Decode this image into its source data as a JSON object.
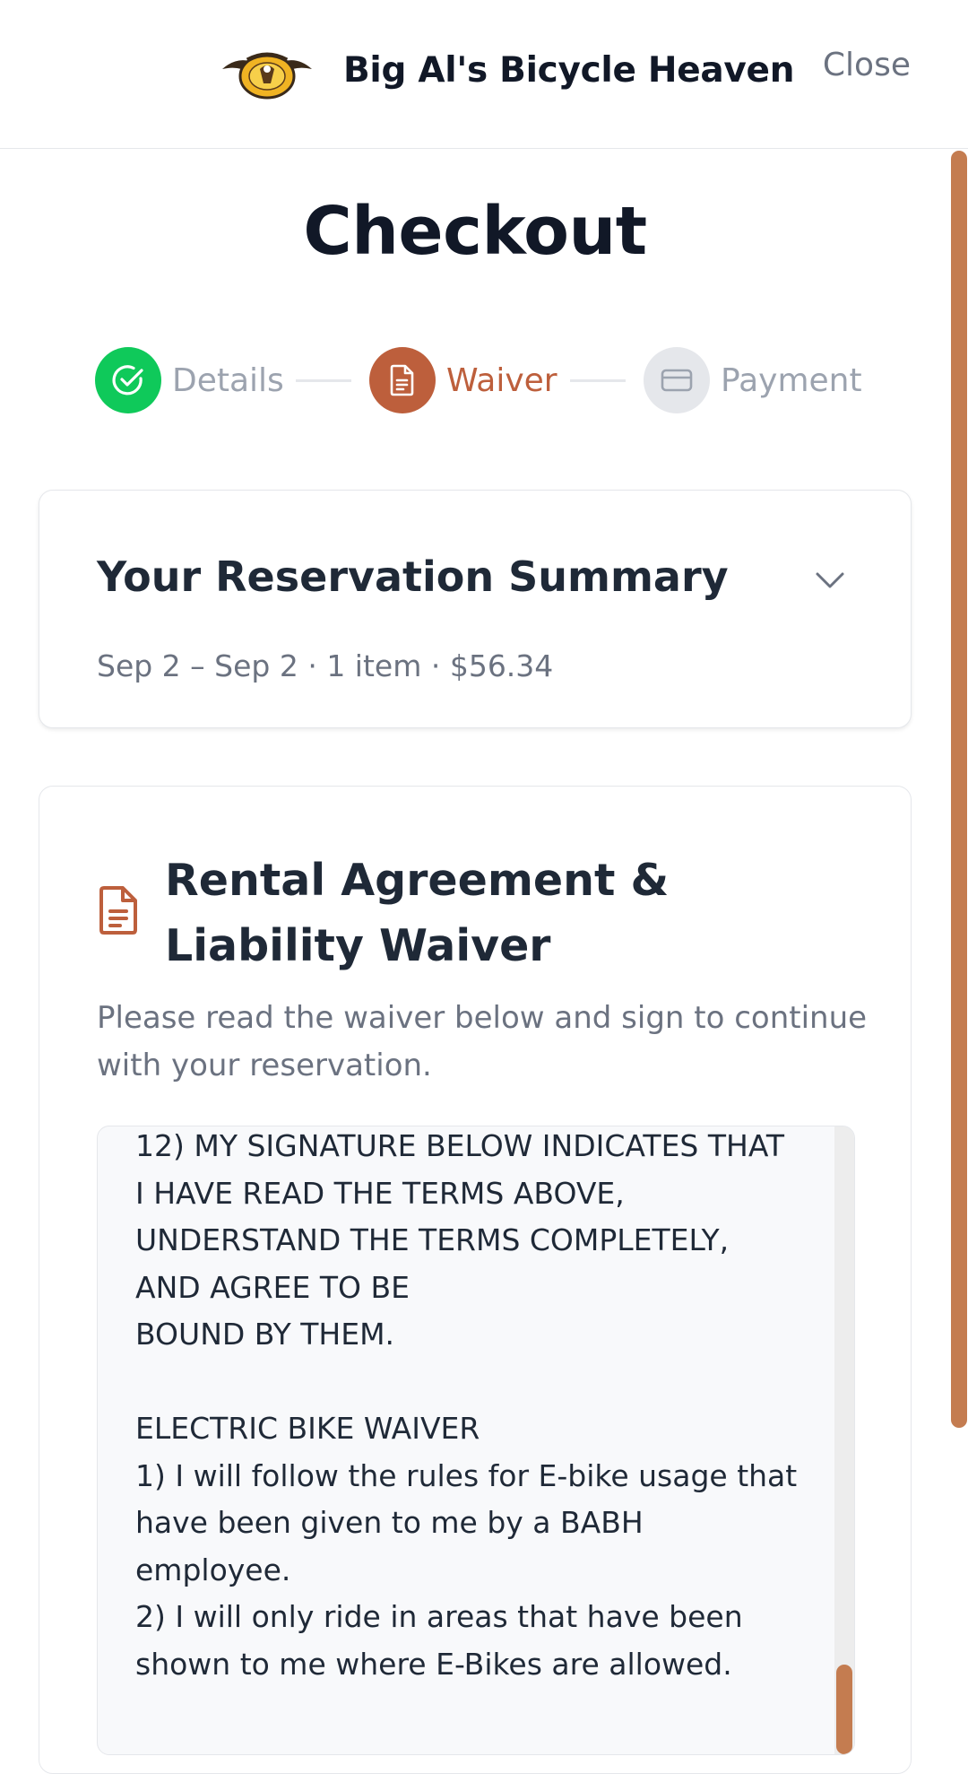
{
  "header": {
    "brand_name": "Big Al's Bicycle Heaven",
    "logo_icon": "eagle-logo-icon",
    "close_label": "Close"
  },
  "page": {
    "title": "Checkout"
  },
  "colors": {
    "accent": "#bd5f3c",
    "scrollbar": "#c47c50",
    "success": "#0fc95a",
    "inactive": "#e5e7eb"
  },
  "stepper": {
    "steps": [
      {
        "label": "Details",
        "status": "complete",
        "icon": "check-circle-icon"
      },
      {
        "label": "Waiver",
        "status": "current",
        "icon": "document-icon"
      },
      {
        "label": "Payment",
        "status": "upcoming",
        "icon": "credit-card-icon"
      }
    ]
  },
  "summary": {
    "title": "Your Reservation Summary",
    "subtitle": "Sep 2 – Sep 2 · 1 item · $56.34",
    "toggle_icon": "chevron-down-icon"
  },
  "waiver": {
    "title": "Rental Agreement & Liability Waiver",
    "description": "Please read the waiver below and sign to continue with your reservation.",
    "icon": "document-icon",
    "text": "12) MY SIGNATURE BELOW INDICATES THAT I HAVE READ THE TERMS ABOVE, UNDERSTAND THE TERMS COMPLETELY, AND AGREE TO BE\nBOUND BY THEM.\n\nELECTRIC BIKE WAIVER\n1) I will follow the rules for E-bike usage that have been given to me by a BABH employee.\n2) I will only ride in areas that have been shown to me where E-Bikes are allowed."
  }
}
